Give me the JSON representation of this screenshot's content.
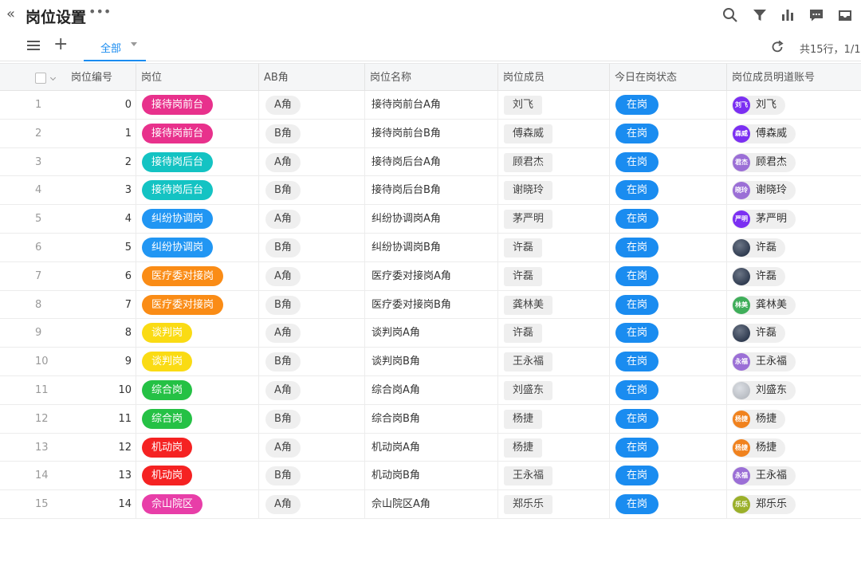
{
  "header": {
    "title": "岗位设置",
    "back_icon": "«",
    "more_icon": "•••"
  },
  "toolbar": {
    "tab_label": "全部",
    "count_text": "共15行，1/1"
  },
  "columns": [
    "岗位编号",
    "岗位",
    "AB角",
    "岗位名称",
    "岗位成员",
    "今日在岗状态",
    "岗位成员明道账号"
  ],
  "colors": {
    "pink": "#e8318c",
    "cyan": "#14c3c3",
    "blue": "#2196f3",
    "orange": "#fa8c16",
    "yellow": "#fadb14",
    "green": "#25c145",
    "red": "#f52222",
    "magenta": "#e83ea8",
    "status_blue": "#1a8cf0"
  },
  "rows": [
    {
      "num": "1",
      "id": "0",
      "post": "接待岗前台",
      "post_color": "#e8318c",
      "ab": "A角",
      "name": "接待岗前台A角",
      "member": "刘飞",
      "status": "在岗",
      "account": "刘飞",
      "avatar_text": "刘飞",
      "avatar_color": "#7b2ff2"
    },
    {
      "num": "2",
      "id": "1",
      "post": "接待岗前台",
      "post_color": "#e8318c",
      "ab": "B角",
      "name": "接待岗前台B角",
      "member": "傅森威",
      "status": "在岗",
      "account": "傅森威",
      "avatar_text": "森威",
      "avatar_color": "#7b2ff2"
    },
    {
      "num": "3",
      "id": "2",
      "post": "接待岗后台",
      "post_color": "#14c3c3",
      "ab": "A角",
      "name": "接待岗后台A角",
      "member": "顾君杰",
      "status": "在岗",
      "account": "顾君杰",
      "avatar_text": "君杰",
      "avatar_color": "#9b6fd6"
    },
    {
      "num": "4",
      "id": "3",
      "post": "接待岗后台",
      "post_color": "#14c3c3",
      "ab": "B角",
      "name": "接待岗后台B角",
      "member": "谢晓玲",
      "status": "在岗",
      "account": "谢晓玲",
      "avatar_text": "晓玲",
      "avatar_color": "#9b6fd6"
    },
    {
      "num": "5",
      "id": "4",
      "post": "纠纷协调岗",
      "post_color": "#2196f3",
      "ab": "A角",
      "name": "纠纷协调岗A角",
      "member": "茅严明",
      "status": "在岗",
      "account": "茅严明",
      "avatar_text": "严明",
      "avatar_color": "#7b2ff2"
    },
    {
      "num": "6",
      "id": "5",
      "post": "纠纷协调岗",
      "post_color": "#2196f3",
      "ab": "B角",
      "name": "纠纷协调岗B角",
      "member": "许磊",
      "status": "在岗",
      "account": "许磊",
      "avatar_text": "",
      "avatar_color": "#1c2b45"
    },
    {
      "num": "7",
      "id": "6",
      "post": "医疗委对接岗",
      "post_color": "#fa8c16",
      "ab": "A角",
      "name": "医疗委对接岗A角",
      "member": "许磊",
      "status": "在岗",
      "account": "许磊",
      "avatar_text": "",
      "avatar_color": "#1c2b45"
    },
    {
      "num": "8",
      "id": "7",
      "post": "医疗委对接岗",
      "post_color": "#fa8c16",
      "ab": "B角",
      "name": "医疗委对接岗B角",
      "member": "龚林美",
      "status": "在岗",
      "account": "龚林美",
      "avatar_text": "林美",
      "avatar_color": "#3fae5a"
    },
    {
      "num": "9",
      "id": "8",
      "post": "谈判岗",
      "post_color": "#fadb14",
      "ab": "A角",
      "name": "谈判岗A角",
      "member": "许磊",
      "status": "在岗",
      "account": "许磊",
      "avatar_text": "",
      "avatar_color": "#1c2b45"
    },
    {
      "num": "10",
      "id": "9",
      "post": "谈判岗",
      "post_color": "#fadb14",
      "ab": "B角",
      "name": "谈判岗B角",
      "member": "王永福",
      "status": "在岗",
      "account": "王永福",
      "avatar_text": "永福",
      "avatar_color": "#9b6fd6"
    },
    {
      "num": "11",
      "id": "10",
      "post": "综合岗",
      "post_color": "#25c145",
      "ab": "A角",
      "name": "综合岗A角",
      "member": "刘盛东",
      "status": "在岗",
      "account": "刘盛东",
      "avatar_text": "",
      "avatar_color": "#c9ced6"
    },
    {
      "num": "12",
      "id": "11",
      "post": "综合岗",
      "post_color": "#25c145",
      "ab": "B角",
      "name": "综合岗B角",
      "member": "杨捷",
      "status": "在岗",
      "account": "杨捷",
      "avatar_text": "杨捷",
      "avatar_color": "#f0821e"
    },
    {
      "num": "13",
      "id": "12",
      "post": "机动岗",
      "post_color": "#f52222",
      "ab": "A角",
      "name": "机动岗A角",
      "member": "杨捷",
      "status": "在岗",
      "account": "杨捷",
      "avatar_text": "杨捷",
      "avatar_color": "#f0821e"
    },
    {
      "num": "14",
      "id": "13",
      "post": "机动岗",
      "post_color": "#f52222",
      "ab": "B角",
      "name": "机动岗B角",
      "member": "王永福",
      "status": "在岗",
      "account": "王永福",
      "avatar_text": "永福",
      "avatar_color": "#9b6fd6"
    },
    {
      "num": "15",
      "id": "14",
      "post": "佘山院区",
      "post_color": "#e83ea8",
      "ab": "A角",
      "name": "佘山院区A角",
      "member": "郑乐乐",
      "status": "在岗",
      "account": "郑乐乐",
      "avatar_text": "乐乐",
      "avatar_color": "#9bb02a"
    }
  ]
}
